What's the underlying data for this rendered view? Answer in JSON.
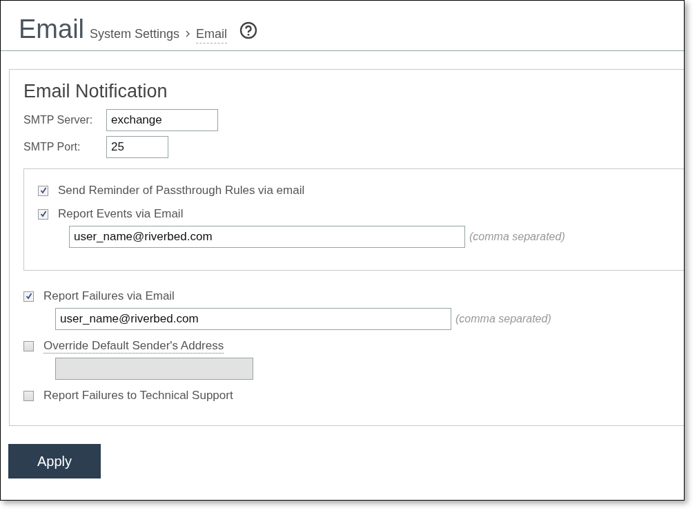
{
  "header": {
    "title": "Email",
    "breadcrumb": [
      {
        "label": "System Settings",
        "current": false
      },
      {
        "label": "Email",
        "current": true
      }
    ]
  },
  "section": {
    "title": "Email Notification",
    "fields": [
      {
        "label": "SMTP Server:",
        "value": "exchange"
      },
      {
        "label": "SMTP Port:",
        "value": "25"
      }
    ],
    "group": [
      {
        "label": "Send Reminder of Passthrough Rules via email",
        "checked": true,
        "dotted_underline": false
      },
      {
        "label": "Report Events via Email",
        "checked": true,
        "dotted_underline": false,
        "field": {
          "value": "user_name@riverbed.com",
          "note": "(comma separated)",
          "disabled": false
        }
      }
    ],
    "options": [
      {
        "label": "Report Failures via Email",
        "checked": true,
        "dotted_underline": false,
        "field": {
          "value": "user_name@riverbed.com",
          "note": "(comma separated)",
          "disabled": false
        }
      },
      {
        "label": "Override Default Sender's Address",
        "checked": false,
        "dotted_underline": true,
        "field": {
          "disabled": true
        }
      },
      {
        "label": "Report Failures to Technical Support",
        "checked": false,
        "dotted_underline": false
      }
    ]
  },
  "buttons": [
    {
      "label": "Apply"
    }
  ]
}
